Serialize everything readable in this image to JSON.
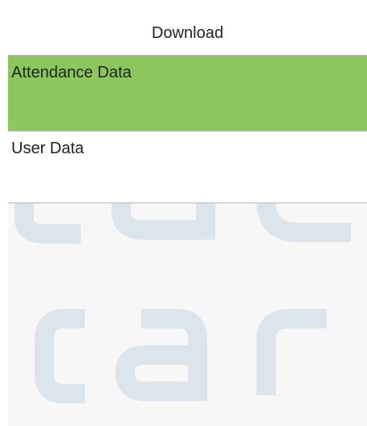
{
  "header": {
    "title": "Download"
  },
  "menu": {
    "items": [
      {
        "label": "Attendance Data",
        "selected": true
      },
      {
        "label": "User Data",
        "selected": false
      }
    ]
  },
  "colors": {
    "selected_background": "#8cc75e",
    "item_background": "#ffffff",
    "screen_background": "#f7f7f7"
  }
}
